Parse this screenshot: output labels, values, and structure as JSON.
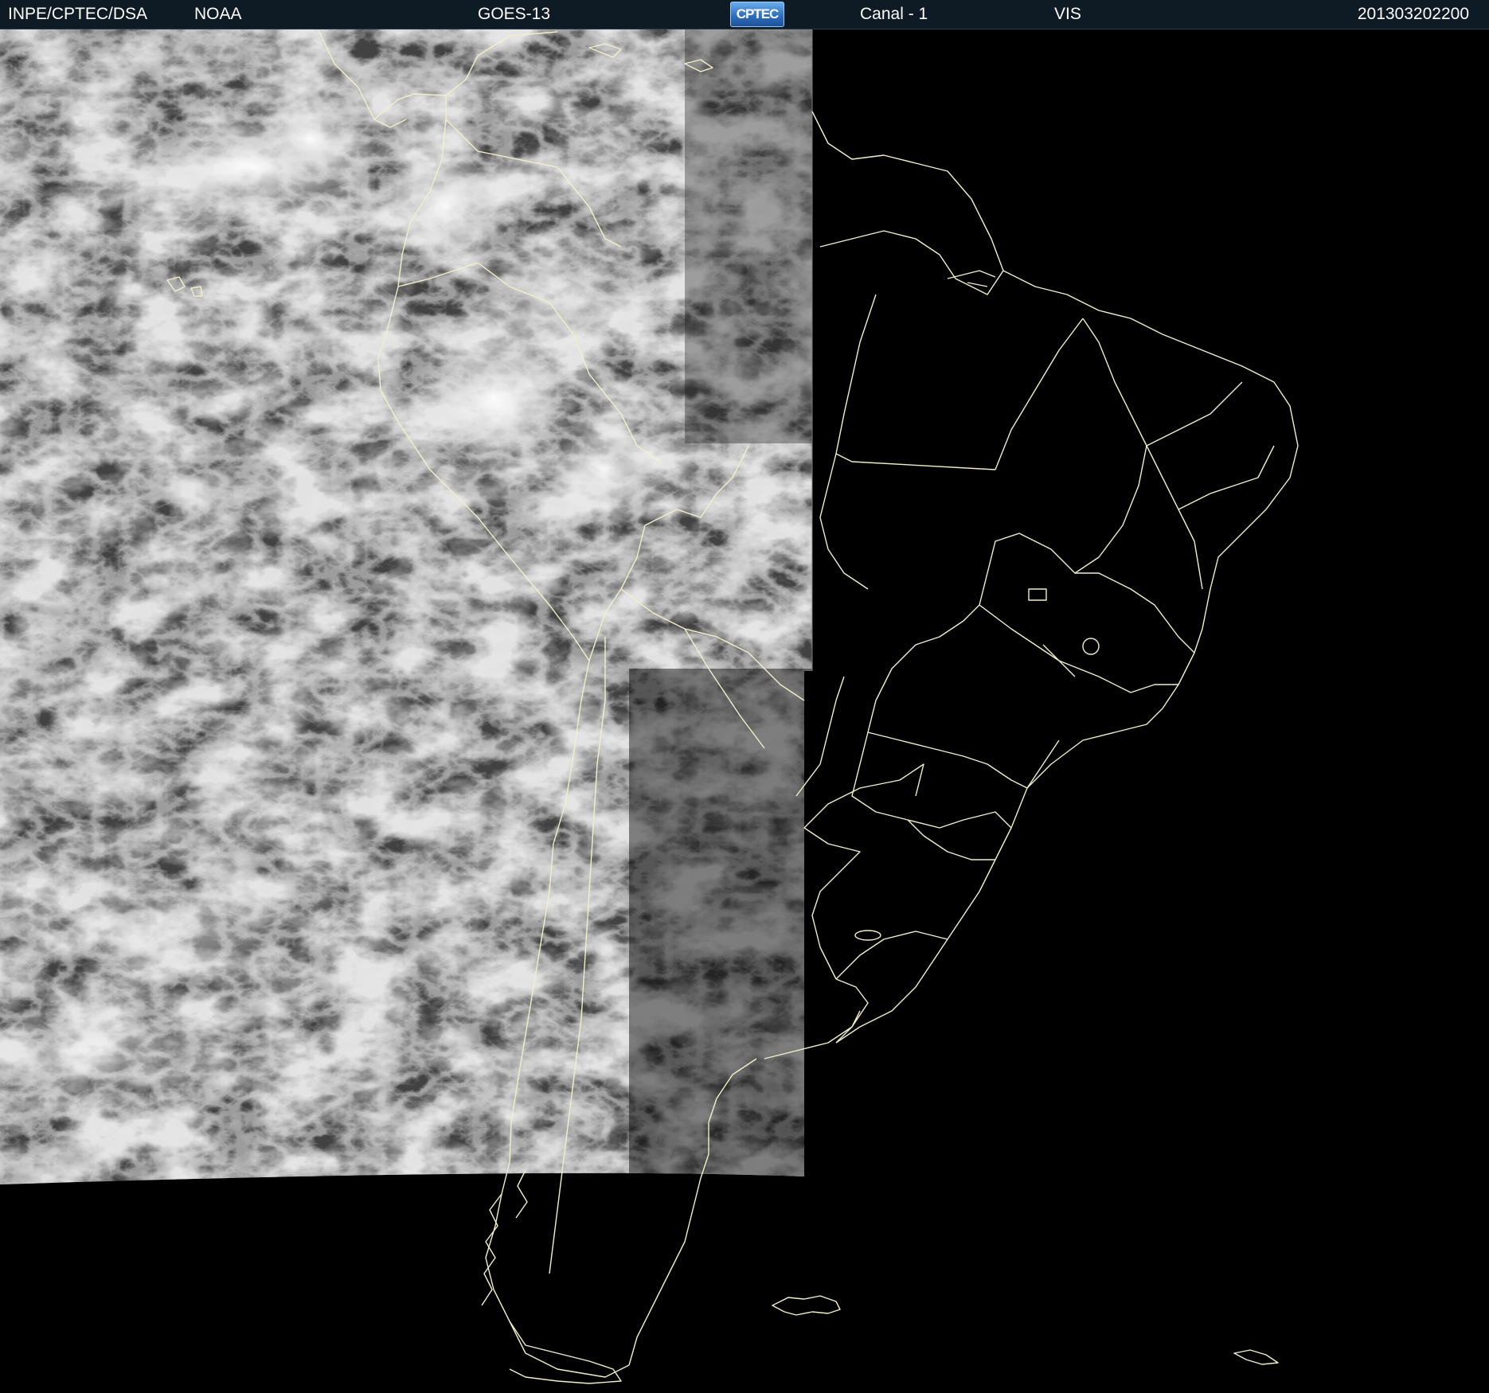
{
  "header": {
    "organization": "INPE/CPTEC/DSA",
    "agency": "NOAA",
    "satellite": "GOES-13",
    "logo_text": "CPTEC",
    "channel": "Canal - 1",
    "band": "VIS",
    "timestamp": "201303202200"
  },
  "colors": {
    "header_bg": "#0e1a24",
    "border": "#f2f0c8",
    "background": "#000000",
    "cloud_light": "#ffffff",
    "cloud_dark": "#3a3a3a"
  },
  "map": {
    "image_type": "satellite visible channel",
    "region": "South America"
  }
}
